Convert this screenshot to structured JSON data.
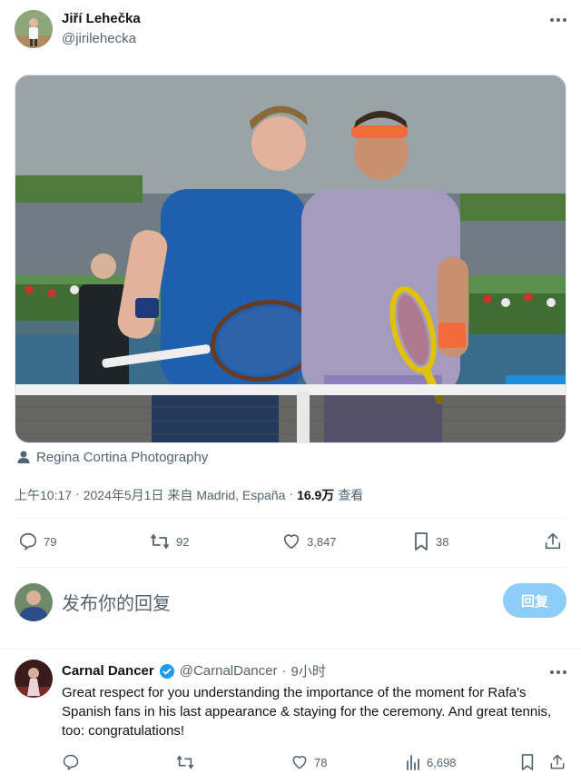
{
  "author": {
    "name": "Jiří Lehečka",
    "handle": "@jirilehecka"
  },
  "more_icon": "more-horizontal-icon",
  "photo": {
    "credit": "Regina Cortina Photography"
  },
  "meta": {
    "time": "上午10:17",
    "sep1": "·",
    "date": "2024年5月1日",
    "from": "来自 Madrid, España",
    "sep2": "·",
    "views": "16.9万",
    "views_label": "查看"
  },
  "actions": {
    "replies": "79",
    "retweets": "92",
    "likes": "3,847",
    "bookmarks": "38"
  },
  "compose": {
    "placeholder": "发布你的回复",
    "button": "回复"
  },
  "reply": {
    "name": "Carnal Dancer",
    "handle": "@CarnalDancer",
    "sep": "·",
    "time": "9小时",
    "text": "Great respect for you understanding the importance of the moment for Rafa's Spanish fans in his last appearance & staying for the ceremony. And great tennis, too: congratulations!",
    "likes": "78",
    "views": "6,698"
  },
  "colors": {
    "accent": "#1d9bf0",
    "reply_button": "#8ecdf8",
    "muted": "#536471"
  }
}
